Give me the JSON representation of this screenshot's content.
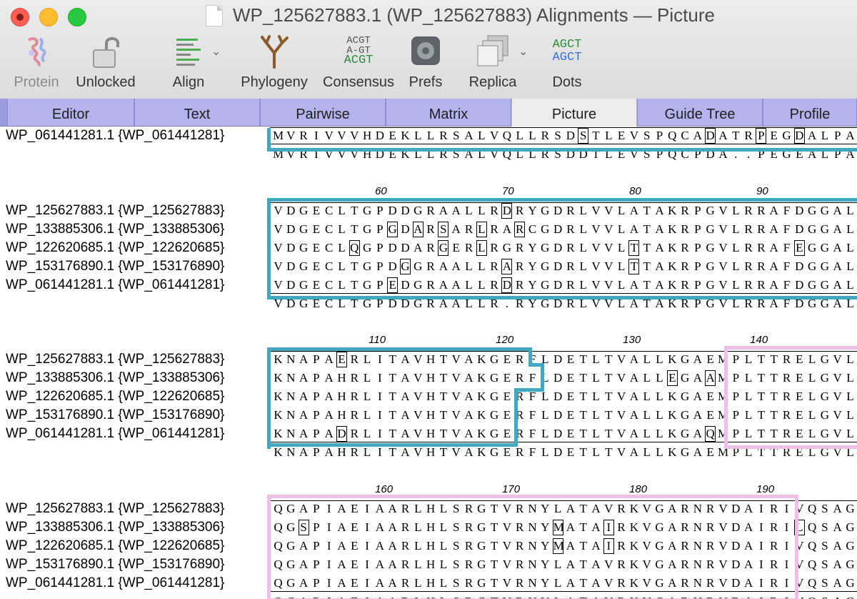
{
  "window": {
    "title": "WP_125627883.1 (WP_125627883) Alignments — Picture"
  },
  "toolbar": {
    "protein": "Protein",
    "unlocked": "Unlocked",
    "align": "Align",
    "phylogeny": "Phylogeny",
    "consensus": "Consensus",
    "consensus_icon": [
      "ACGT",
      "A-GT",
      "ACGT"
    ],
    "prefs": "Prefs",
    "replica": "Replica",
    "dots": "Dots",
    "dots_icon": [
      "AGCT",
      "AGCT"
    ]
  },
  "tabs": [
    "Editor",
    "Text",
    "Pairwise",
    "Matrix",
    "Picture",
    "Guide Tree",
    "Profile"
  ],
  "active_tab": "Picture",
  "colors": {
    "region_teal": "#41a7c3",
    "region_pink": "#f1bee9",
    "tab_bg": "#b4b3ee",
    "toolbar_bg": "#ececec"
  },
  "blocks": [
    {
      "ticks": [],
      "names": [
        "WP_061441281.1 {WP_061441281}"
      ],
      "rows": [
        "MVRIVVVHDEKLLRSALVQLLRSDSTLEVSPQCADATRPEGDALPA"
      ],
      "consensus": "MVRIVVVHDEKLLRSALVQLLRSDDTLEVSPQCPDA..PEGEALPA"
    },
    {
      "ticks": [
        "60",
        "70",
        "80",
        "90"
      ],
      "names": [
        "WP_125627883.1 {WP_125627883}",
        "WP_133885306.1 {WP_133885306}",
        "WP_122620685.1 {WP_122620685}",
        "WP_153176890.1 {WP_153176890}",
        "WP_061441281.1 {WP_061441281}"
      ],
      "rows": [
        "VDGECLTGPDDGRAALLRDRYGDRLVVLATAKRPGVLRRAFDGGAL",
        "VDGECLTGPGDARSARLRARCGDRLVVLATAKRPGVLRRAFDGGAL",
        "VDGECLQGPDDARGERLRGRYGDRLVVLTTAKRPGVLRRAFEGGAL",
        "VDGECLTGPDGGRAALLRARYGDRLVVLTTAKRPGVLRRAFDGGAL",
        "VDGECLTGPEDGRAALLRDRYGDRLVVLATAKRPGVLRRAFDGGAL"
      ],
      "consensus": "VDGECLTGPDDGRAALLR.RYGDRLVVLATAKRPGVLRRAFDGGAL"
    },
    {
      "ticks": [
        "110",
        "120",
        "130",
        "140"
      ],
      "names": [
        "WP_125627883.1 {WP_125627883}",
        "WP_133885306.1 {WP_133885306}",
        "WP_122620685.1 {WP_122620685}",
        "WP_153176890.1 {WP_153176890}",
        "WP_061441281.1 {WP_061441281}"
      ],
      "rows": [
        "KNAPAERLITAVHTVAKGERFLDETLTVALLKGAEMPLTTRELGVL",
        "KNAPAHRLITAVHTVAKGERFLDETLTVALLEGAAMPLTTRELGVL",
        "KNAPAHRLITAVHTVAKGERFLDETLTVALLKGAEMPLTTRELGVL",
        "KNAPAHRLITAVHTVAKGERFLDETLTVALLKGAEMPLTTRELGVL",
        "KNAPADRLITAVHTVAKGERFLDETLTVALLKGAQMPLTTRELGVL"
      ],
      "consensus": "KNAPAHRLITAVHTVAKGERFLDETLTVALLKGAEMPLTTRELGVL"
    },
    {
      "ticks": [
        "160",
        "170",
        "180",
        "190"
      ],
      "names": [
        "WP_125627883.1 {WP_125627883}",
        "WP_133885306.1 {WP_133885306}",
        "WP_122620685.1 {WP_122620685}",
        "WP_153176890.1 {WP_153176890}",
        "WP_061441281.1 {WP_061441281}"
      ],
      "rows": [
        "QGAPIAEIAARLHLSRGTVRNYLATAVRKVGARNRVDAIRIVQSAG",
        "QGSPIAEIAARLHLSRGTVRNYMATAIRKVGARNRVDAIRILQSAG",
        "QGAPIAEIAARLHLSRGTVRNYMATAIRKVGARNRVDAIRIVQSAG",
        "QGAPIAEIAARLHLSRGTVRNYLATAVRKVGARNRVDAIRIVQSAG",
        "QGAPIAEIAARLHLSRGTVRNYLATAVRKVGARNRVDAIRIVQSAG"
      ],
      "consensus": "QGAPIAEIAARLHLSRGTVRNYLATAVRKVGARNRVDAIRIVQSAG"
    }
  ]
}
